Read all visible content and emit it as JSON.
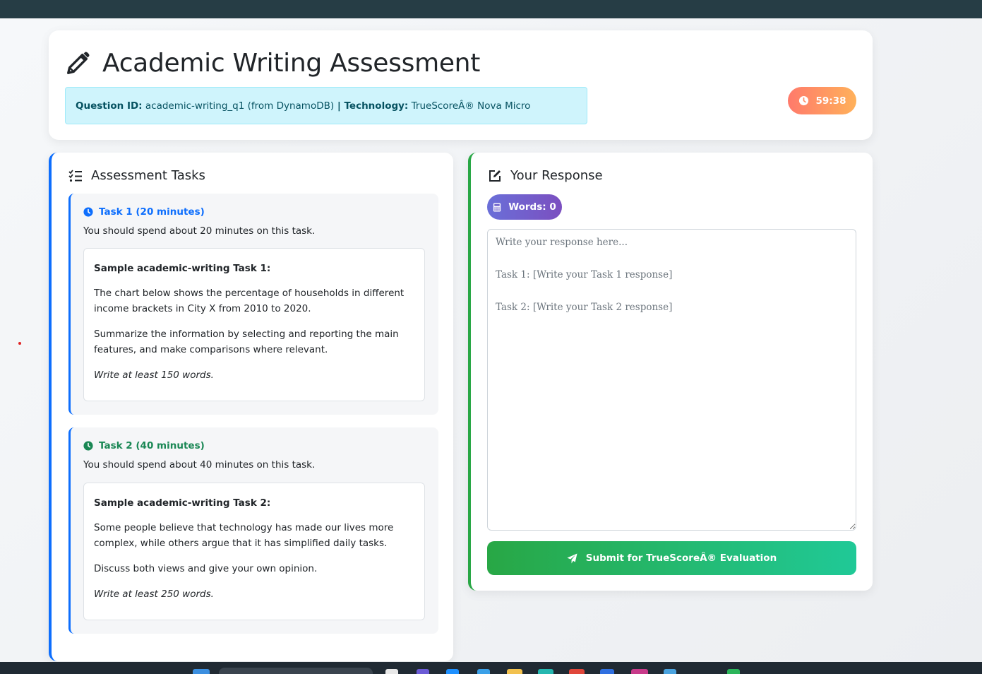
{
  "header": {
    "title": "Academic Writing Assessment",
    "question_label": "Question ID:",
    "question_value": "academic-writing_q1 (from DynamoDB)",
    "separator": " | ",
    "technology_label": "Technology:",
    "technology_value": "TrueScoreÂ® Nova Micro",
    "timer": "59:38"
  },
  "tasks_panel": {
    "title": "Assessment Tasks",
    "tasks": [
      {
        "heading": "Task 1 (20 minutes)",
        "note": "You should spend about 20 minutes on this task.",
        "sample_title": "Sample academic-writing Task 1:",
        "paragraph_1": "The chart below shows the percentage of households in different income brackets in City X from 2010 to 2020.",
        "paragraph_2": "Summarize the information by selecting and reporting the main features, and make comparisons where relevant.",
        "min_words": "Write at least 150 words."
      },
      {
        "heading": "Task 2 (40 minutes)",
        "note": "You should spend about 40 minutes on this task.",
        "sample_title": "Sample academic-writing Task 2:",
        "paragraph_1": "Some people believe that technology has made our lives more complex, while others argue that it has simplified daily tasks.",
        "paragraph_2": "Discuss both views and give your own opinion.",
        "min_words": "Write at least 250 words."
      }
    ]
  },
  "response_panel": {
    "title": "Your Response",
    "word_count": "Words: 0",
    "placeholder": "Write your response here...\n\nTask 1: [Write your Task 1 response]\n\nTask 2: [Write your Task 2 response]",
    "submit_label": "Submit for TrueScoreÂ® Evaluation"
  },
  "icons": {
    "title": "pencil-icon",
    "timer": "clock-icon",
    "tasks": "task-list-icon",
    "response": "edit-icon",
    "words": "calculator-icon",
    "submit": "paper-plane-icon"
  },
  "colors": {
    "primary": "#0d6efd",
    "success": "#28a745",
    "task2": "#198754",
    "info_bg": "#cff4fc",
    "timer_start": "#ff7a6b",
    "timer_end": "#ffb15a",
    "badge_start": "#6a6fd8",
    "badge_end": "#7b4fc0",
    "submit_end": "#20c997"
  }
}
